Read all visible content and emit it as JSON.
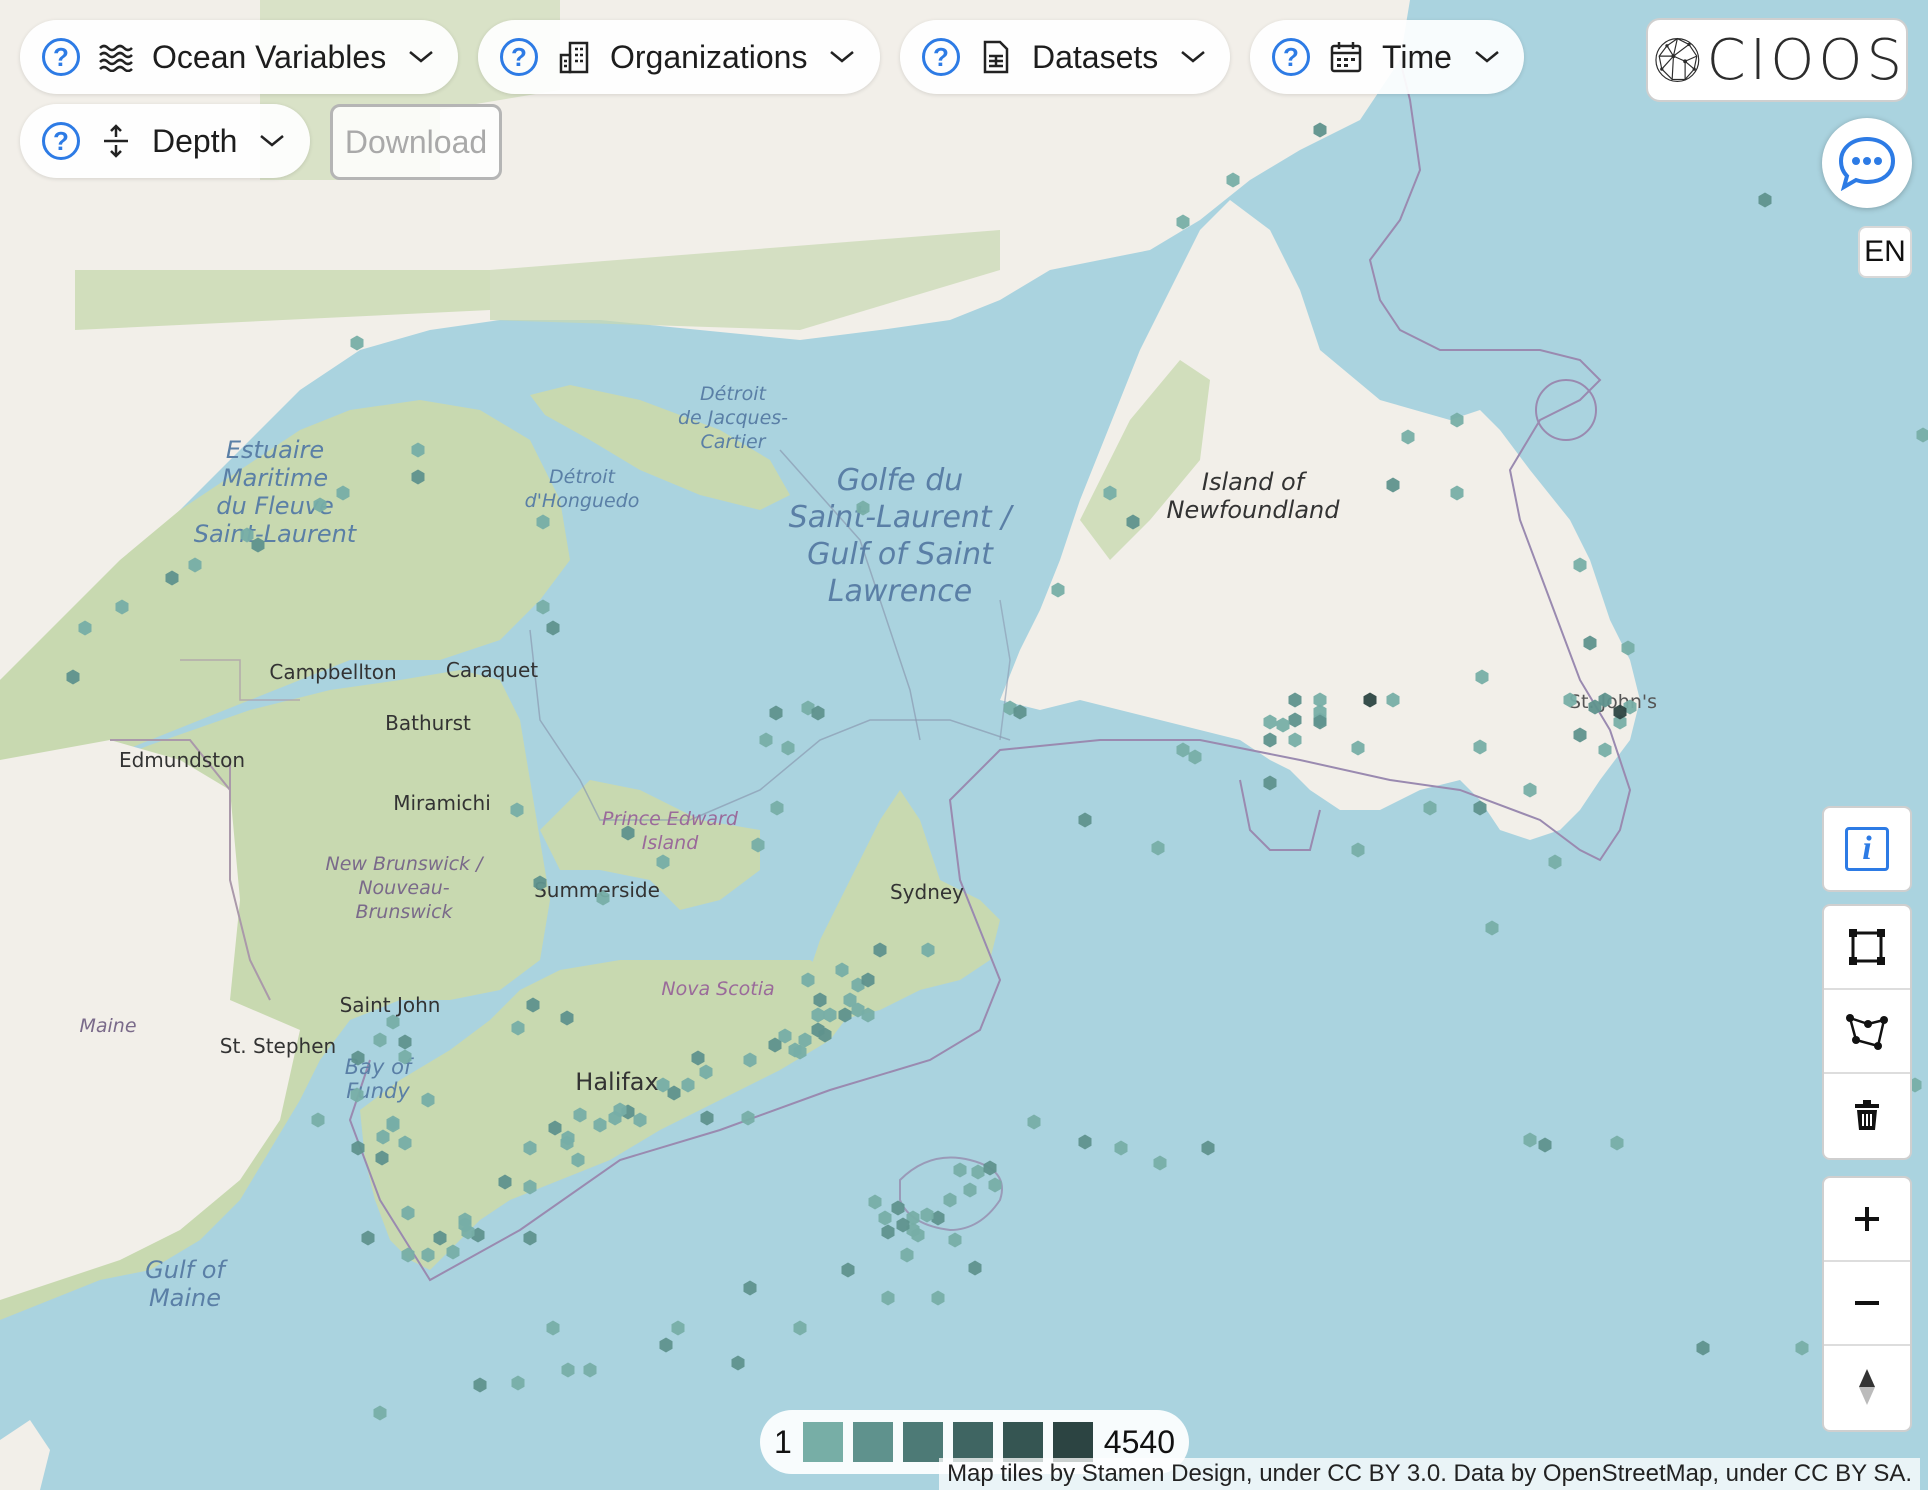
{
  "filters": {
    "ocean_variables": "Ocean Variables",
    "organizations": "Organizations",
    "datasets": "Datasets",
    "time": "Time",
    "depth": "Depth",
    "help_symbol": "?"
  },
  "download_label": "Download",
  "logo_text": "CIOOS",
  "language": "EN",
  "info_symbol": "i",
  "legend": {
    "min": "1",
    "max": "4540",
    "colors": [
      "#77aea6",
      "#5f928d",
      "#4d7a76",
      "#3f6562",
      "#355552",
      "#2c4442"
    ]
  },
  "attribution": "Map tiles by Stamen Design, under CC BY 3.0. Data by OpenStreetMap, under CC BY SA.",
  "map": {
    "water_labels": {
      "estuary": [
        "Estuaire",
        "Maritime",
        "du Fleuve",
        "Saint-Laurent"
      ],
      "jacques_cartier": [
        "Détroit",
        "de Jacques-",
        "Cartier"
      ],
      "honguedo": [
        "Détroit",
        "d'Honguedo"
      ],
      "gulf": [
        "Golfe du",
        "Saint-Laurent /",
        "Gulf of Saint",
        "Lawrence"
      ],
      "bay_of_fundy": [
        "Bay of",
        "Fundy"
      ],
      "gulf_of_maine": [
        "Gulf of",
        "Maine"
      ]
    },
    "region_labels": {
      "newfoundland": [
        "Island of",
        "Newfoundland"
      ],
      "pei": [
        "Prince Edward",
        "Island"
      ],
      "new_brunswick": [
        "New Brunswick /",
        "Nouveau-",
        "Brunswick"
      ],
      "nova_scotia": "Nova Scotia",
      "maine": "Maine"
    },
    "cities": {
      "campbellton": "Campbellton",
      "caraquet": "Caraquet",
      "bathurst": "Bathurst",
      "edmundston": "Edmundston",
      "miramichi": "Miramichi",
      "summerside": "Summerside",
      "sydney": "Sydney",
      "saint_john": "Saint John",
      "st_stephen": "St. Stephen",
      "halifax": "Halifax",
      "st_johns": "St. John's"
    }
  }
}
